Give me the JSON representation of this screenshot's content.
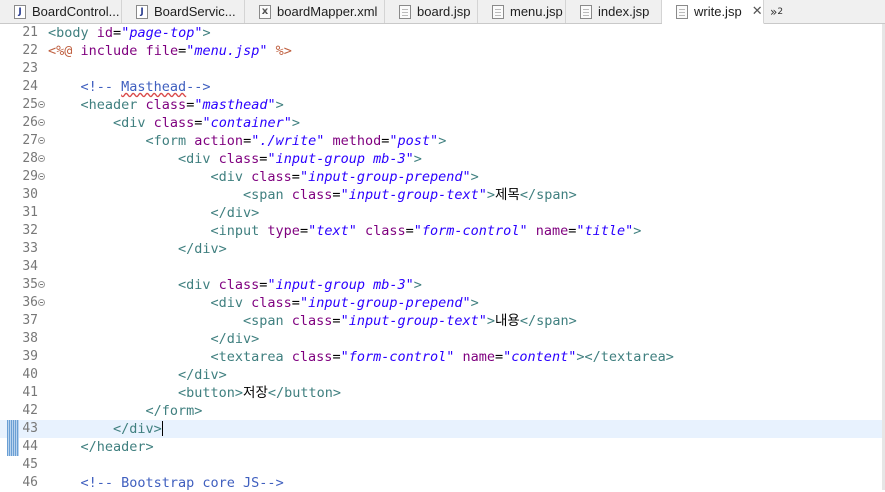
{
  "tabs": [
    {
      "label": "BoardControl...",
      "icon": "java-file-icon",
      "kind": "java",
      "active": false
    },
    {
      "label": "BoardServic...",
      "icon": "java-file-icon",
      "kind": "java",
      "active": false
    },
    {
      "label": "boardMapper.xml",
      "icon": "xml-file-icon",
      "kind": "xml",
      "active": false
    },
    {
      "label": "board.jsp",
      "icon": "jsp-file-icon",
      "kind": "jsp",
      "active": false
    },
    {
      "label": "menu.jsp",
      "icon": "jsp-file-icon",
      "kind": "jsp",
      "active": false
    },
    {
      "label": "index.jsp",
      "icon": "jsp-file-icon",
      "kind": "jsp",
      "active": false
    },
    {
      "label": "write.jsp",
      "icon": "jsp-file-icon",
      "kind": "jsp",
      "active": true
    }
  ],
  "overflow_label": "»",
  "overflow_count": "2",
  "close_glyph": "✕",
  "editor": {
    "current_line": 43,
    "lines": [
      {
        "n": 21,
        "fold": false,
        "indent": 0,
        "tokens": [
          [
            "tag",
            "<body"
          ],
          [
            "text",
            " "
          ],
          [
            "attr",
            "id"
          ],
          [
            "text",
            "="
          ],
          [
            "str",
            "\"page-top\""
          ],
          [
            "tag",
            ">"
          ]
        ]
      },
      {
        "n": 22,
        "fold": false,
        "indent": 0,
        "tokens": [
          [
            "dir",
            "<%@"
          ],
          [
            "text",
            " "
          ],
          [
            "attr",
            "include"
          ],
          [
            "text",
            " "
          ],
          [
            "attr",
            "file"
          ],
          [
            "text",
            "="
          ],
          [
            "str",
            "\"menu.jsp\""
          ],
          [
            "text",
            " "
          ],
          [
            "dir",
            "%>"
          ]
        ]
      },
      {
        "n": 23,
        "fold": false,
        "indent": 0,
        "tokens": []
      },
      {
        "n": 24,
        "fold": false,
        "indent": 1,
        "tokens": [
          [
            "com",
            "<!-- "
          ],
          [
            "comsq",
            "Masthead"
          ],
          [
            "com",
            "-->"
          ]
        ]
      },
      {
        "n": 25,
        "fold": true,
        "indent": 1,
        "tokens": [
          [
            "tag",
            "<header"
          ],
          [
            "text",
            " "
          ],
          [
            "attr",
            "class"
          ],
          [
            "text",
            "="
          ],
          [
            "str",
            "\"masthead\""
          ],
          [
            "tag",
            ">"
          ]
        ]
      },
      {
        "n": 26,
        "fold": true,
        "indent": 2,
        "tokens": [
          [
            "tag",
            "<div"
          ],
          [
            "text",
            " "
          ],
          [
            "attr",
            "class"
          ],
          [
            "text",
            "="
          ],
          [
            "str",
            "\"container\""
          ],
          [
            "tag",
            ">"
          ]
        ]
      },
      {
        "n": 27,
        "fold": true,
        "indent": 3,
        "tokens": [
          [
            "tag",
            "<form"
          ],
          [
            "text",
            " "
          ],
          [
            "attr",
            "action"
          ],
          [
            "text",
            "="
          ],
          [
            "str",
            "\"./write\""
          ],
          [
            "text",
            " "
          ],
          [
            "attr",
            "method"
          ],
          [
            "text",
            "="
          ],
          [
            "str",
            "\"post\""
          ],
          [
            "tag",
            ">"
          ]
        ]
      },
      {
        "n": 28,
        "fold": true,
        "indent": 4,
        "tokens": [
          [
            "tag",
            "<div"
          ],
          [
            "text",
            " "
          ],
          [
            "attr",
            "class"
          ],
          [
            "text",
            "="
          ],
          [
            "str",
            "\"input-group mb-3\""
          ],
          [
            "tag",
            ">"
          ]
        ]
      },
      {
        "n": 29,
        "fold": true,
        "indent": 5,
        "tokens": [
          [
            "tag",
            "<div"
          ],
          [
            "text",
            " "
          ],
          [
            "attr",
            "class"
          ],
          [
            "text",
            "="
          ],
          [
            "str",
            "\"input-group-prepend\""
          ],
          [
            "tag",
            ">"
          ]
        ]
      },
      {
        "n": 30,
        "fold": false,
        "indent": 6,
        "tokens": [
          [
            "tag",
            "<span"
          ],
          [
            "text",
            " "
          ],
          [
            "attr",
            "class"
          ],
          [
            "text",
            "="
          ],
          [
            "str",
            "\"input-group-text\""
          ],
          [
            "tag",
            ">"
          ],
          [
            "text",
            "제목"
          ],
          [
            "tag",
            "</span>"
          ]
        ]
      },
      {
        "n": 31,
        "fold": false,
        "indent": 5,
        "tokens": [
          [
            "tag",
            "</div>"
          ]
        ]
      },
      {
        "n": 32,
        "fold": false,
        "indent": 5,
        "tokens": [
          [
            "tag",
            "<input"
          ],
          [
            "text",
            " "
          ],
          [
            "attr",
            "type"
          ],
          [
            "text",
            "="
          ],
          [
            "str",
            "\"text\""
          ],
          [
            "text",
            " "
          ],
          [
            "attr",
            "class"
          ],
          [
            "text",
            "="
          ],
          [
            "str",
            "\"form-control\""
          ],
          [
            "text",
            " "
          ],
          [
            "attr",
            "name"
          ],
          [
            "text",
            "="
          ],
          [
            "str",
            "\"title\""
          ],
          [
            "tag",
            ">"
          ]
        ]
      },
      {
        "n": 33,
        "fold": false,
        "indent": 4,
        "tokens": [
          [
            "tag",
            "</div>"
          ]
        ]
      },
      {
        "n": 34,
        "fold": false,
        "indent": 0,
        "tokens": []
      },
      {
        "n": 35,
        "fold": true,
        "indent": 4,
        "tokens": [
          [
            "tag",
            "<div"
          ],
          [
            "text",
            " "
          ],
          [
            "attr",
            "class"
          ],
          [
            "text",
            "="
          ],
          [
            "str",
            "\"input-group mb-3\""
          ],
          [
            "tag",
            ">"
          ]
        ]
      },
      {
        "n": 36,
        "fold": true,
        "indent": 5,
        "tokens": [
          [
            "tag",
            "<div"
          ],
          [
            "text",
            " "
          ],
          [
            "attr",
            "class"
          ],
          [
            "text",
            "="
          ],
          [
            "str",
            "\"input-group-prepend\""
          ],
          [
            "tag",
            ">"
          ]
        ]
      },
      {
        "n": 37,
        "fold": false,
        "indent": 6,
        "tokens": [
          [
            "tag",
            "<span"
          ],
          [
            "text",
            " "
          ],
          [
            "attr",
            "class"
          ],
          [
            "text",
            "="
          ],
          [
            "str",
            "\"input-group-text\""
          ],
          [
            "tag",
            ">"
          ],
          [
            "text",
            "내용"
          ],
          [
            "tag",
            "</span>"
          ]
        ]
      },
      {
        "n": 38,
        "fold": false,
        "indent": 5,
        "tokens": [
          [
            "tag",
            "</div>"
          ]
        ]
      },
      {
        "n": 39,
        "fold": false,
        "indent": 5,
        "tokens": [
          [
            "tag",
            "<textarea"
          ],
          [
            "text",
            " "
          ],
          [
            "attr",
            "class"
          ],
          [
            "text",
            "="
          ],
          [
            "str",
            "\"form-control\""
          ],
          [
            "text",
            " "
          ],
          [
            "attr",
            "name"
          ],
          [
            "text",
            "="
          ],
          [
            "str",
            "\"content\""
          ],
          [
            "tag",
            "></textarea>"
          ]
        ]
      },
      {
        "n": 40,
        "fold": false,
        "indent": 4,
        "tokens": [
          [
            "tag",
            "</div>"
          ]
        ]
      },
      {
        "n": 41,
        "fold": false,
        "indent": 4,
        "tokens": [
          [
            "tag",
            "<button>"
          ],
          [
            "text",
            "저장"
          ],
          [
            "tag",
            "</button>"
          ]
        ]
      },
      {
        "n": 42,
        "fold": false,
        "indent": 3,
        "tokens": [
          [
            "tag",
            "</form>"
          ]
        ]
      },
      {
        "n": 43,
        "fold": false,
        "indent": 2,
        "tokens": [
          [
            "tag",
            "</div>"
          ]
        ]
      },
      {
        "n": 44,
        "fold": false,
        "indent": 1,
        "tokens": [
          [
            "tag",
            "</header>"
          ]
        ]
      },
      {
        "n": 45,
        "fold": false,
        "indent": 0,
        "tokens": []
      },
      {
        "n": 46,
        "fold": false,
        "indent": 1,
        "tokens": [
          [
            "com",
            "<!-- Bootstrap core JS-->"
          ]
        ]
      }
    ]
  }
}
